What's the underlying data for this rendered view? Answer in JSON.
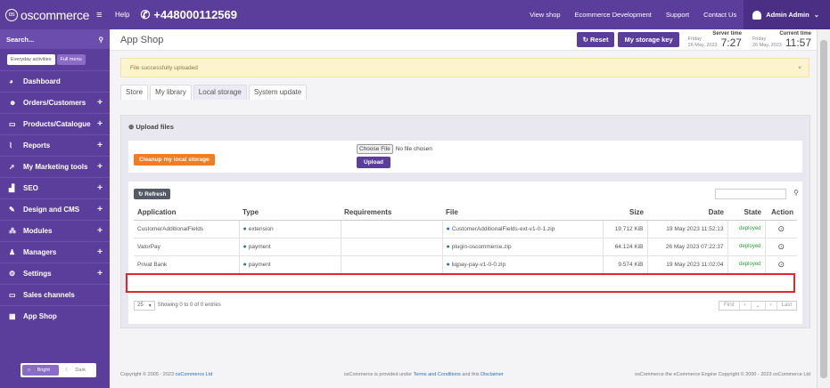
{
  "topbar": {
    "logo": "oscommerce",
    "help": "Help",
    "phone": "+448000112569",
    "links": [
      "View shop",
      "Ecommerce Development",
      "Support",
      "Contact Us"
    ],
    "user": "Admin Admin"
  },
  "sidebar": {
    "search_placeholder": "Search...",
    "toggle_everyday": "Everyday activities",
    "toggle_full": "Full menu",
    "items": [
      {
        "label": "Dashboard",
        "plus": false
      },
      {
        "label": "Orders/Customers",
        "plus": true
      },
      {
        "label": "Products/Catalogue",
        "plus": true
      },
      {
        "label": "Reports",
        "plus": true
      },
      {
        "label": "My Marketing tools",
        "plus": true
      },
      {
        "label": "SEO",
        "plus": true
      },
      {
        "label": "Design and CMS",
        "plus": true
      },
      {
        "label": "Modules",
        "plus": true
      },
      {
        "label": "Managers",
        "plus": true
      },
      {
        "label": "Settings",
        "plus": true
      },
      {
        "label": "Sales channels",
        "plus": false
      },
      {
        "label": "App Shop",
        "plus": false
      }
    ],
    "theme_bright": "Bright",
    "theme_dark": "Dark"
  },
  "header": {
    "title": "App Shop",
    "reset": "Reset",
    "storage_key": "My storage key",
    "server_label": "Server time",
    "server_day": "Friday",
    "server_date": "26 May, 2023",
    "server_time": "7:27",
    "current_label": "Current time",
    "current_day": "Friday",
    "current_date": "26 May, 2023",
    "current_time": "11:57"
  },
  "alert": {
    "text": "File successfully uploaded",
    "close": "×"
  },
  "tabs": [
    "Store",
    "My library",
    "Local storage",
    "System update"
  ],
  "upload": {
    "title": "Upload files",
    "cleanup": "Cleanup my local storage",
    "choose_file": "Choose File",
    "no_file": "No file chosen",
    "upload": "Upload"
  },
  "table": {
    "refresh": "Refresh",
    "headers": [
      "Application",
      "Type",
      "Requirements",
      "File",
      "Size",
      "Date",
      "State",
      "Action"
    ],
    "rows": [
      {
        "application": "CustomerAdditionalFields",
        "type": "extension",
        "requirements": "",
        "file": "CustomerAdditionalFields-ext-v1-0-1.zip",
        "size": "19.712 KiB",
        "date": "19 May 2023 11:52:13",
        "state": "deployed"
      },
      {
        "application": "ValorPay",
        "type": "payment",
        "requirements": "",
        "file": "plugin-oscommerce.zip",
        "size": "64.124 KiB",
        "date": "26 May 2023 07:22:37",
        "state": "deployed"
      },
      {
        "application": "Privat Bank",
        "type": "payment",
        "requirements": "",
        "file": "liqpay-pay-v1-0-0.zip",
        "size": "9.574 KiB",
        "date": "19 May 2023 11:02:04",
        "state": "deployed"
      }
    ],
    "per_page": "25",
    "showing": "Showing 0 to 0 of 0 entries",
    "pager_first": "First",
    "pager_last": "Last"
  },
  "footer": {
    "copyright": "Copyright © 2005 - 2023",
    "copyright_link": "osCommerce Ltd",
    "middle_pre": "osCommerce is provided under",
    "middle_link1": "Terms and Conditions",
    "middle_and": "and this",
    "middle_link2": "Disclaimer",
    "right": "osCommerce the eCommerce Engine Copyright © 2000 - 2023 osCommerce Ltd"
  }
}
